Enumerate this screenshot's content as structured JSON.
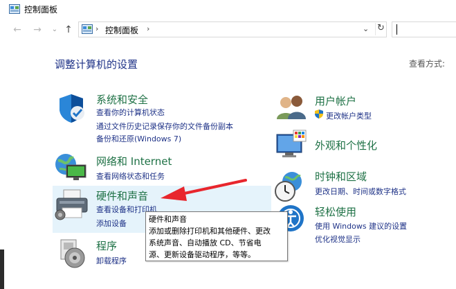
{
  "window": {
    "title": "控制面板"
  },
  "nav": {
    "back_icon": "back-arrow-icon",
    "forward_icon": "forward-arrow-icon",
    "recent_icon": "chevron-down-icon",
    "up_icon": "up-arrow-icon",
    "breadcrumb": "控制面板",
    "search_placeholder": ""
  },
  "main": {
    "heading": "调整计算机的设置",
    "view_by": "查看方式:"
  },
  "categories_left": [
    {
      "title": "系统和安全",
      "icon": "shield-icon",
      "links": [
        "查看你的计算机状态",
        "通过文件历史记录保存你的文件备份副本",
        "备份和还原(Windows 7)"
      ]
    },
    {
      "title": "网络和 Internet",
      "icon": "network-icon",
      "links": [
        "查看网络状态和任务"
      ]
    },
    {
      "title": "硬件和声音",
      "icon": "printer-icon",
      "links": [
        "查看设备和打印机",
        "添加设备"
      ]
    },
    {
      "title": "程序",
      "icon": "programs-icon",
      "links": [
        "卸载程序"
      ]
    }
  ],
  "categories_right": [
    {
      "title": "用户帐户",
      "icon": "users-icon",
      "links": [
        "更改帐户类型"
      ]
    },
    {
      "title": "外观和个性化",
      "icon": "monitor-icon",
      "links": []
    },
    {
      "title": "时钟和区域",
      "icon": "clock-globe-icon",
      "links": [
        "更改日期、时间或数字格式"
      ]
    },
    {
      "title": "轻松使用",
      "icon": "ease-of-access-icon",
      "links": [
        "使用 Windows 建议的设置",
        "优化视觉显示"
      ]
    }
  ],
  "tooltip": {
    "title": "硬件和声音",
    "lines": [
      "添加或删除打印机和其他硬件、更改",
      "系统声音、自动播放 CD、节省电",
      "源、更新设备驱动程序，等等。"
    ]
  },
  "colors": {
    "link_blue": "#1e3287",
    "category_green": "#1e7145",
    "highlight": "#e5f3fb",
    "arrow_red": "#e8262d"
  }
}
